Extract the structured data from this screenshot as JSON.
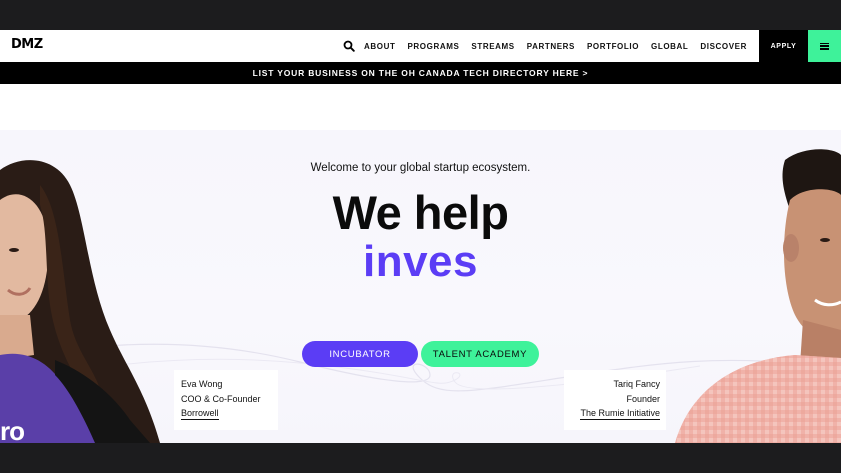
{
  "nav": {
    "logo": "DMZ",
    "links": [
      "ABOUT",
      "PROGRAMS",
      "STREAMS",
      "PARTNERS",
      "PORTFOLIO",
      "GLOBAL",
      "DISCOVER"
    ],
    "apply_label": "APPLY",
    "search_icon": "search-icon",
    "menu_icon": "hamburger-menu-icon"
  },
  "banner": {
    "text": "LIST YOUR BUSINESS ON THE OH CANADA TECH DIRECTORY HERE >"
  },
  "hero": {
    "welcome": "Welcome to your global startup ecosystem.",
    "headline": "We help",
    "typed": "inves",
    "buttons": {
      "incubator": "INCUBATOR",
      "talent": "TALENT ACADEMY"
    },
    "left_person": {
      "name": "Eva Wong",
      "title": "COO & Co-Founder",
      "company": "Borrowell",
      "shirt_text": "ro"
    },
    "right_person": {
      "name": "Tariq Fancy",
      "title": "Founder",
      "company": "The Rumie Initiative"
    }
  },
  "colors": {
    "accent_purple": "#5b3df5",
    "accent_green": "#3ef29a",
    "dark": "#1c1c1e"
  }
}
